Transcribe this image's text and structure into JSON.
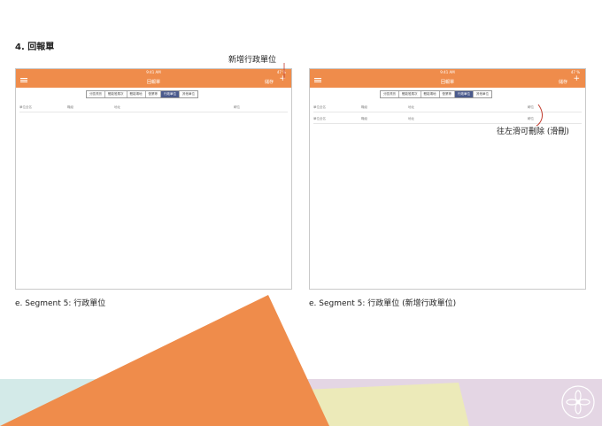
{
  "page": {
    "section_title": "4. 回報單",
    "captions": [
      "e. Segment 5: 行政單位",
      "e. Segment 5: 行政單位 (新增行政單位)"
    ],
    "callouts": {
      "add_unit": "新增行政單位",
      "swipe_delete": "往左滑可刪除 (滑刪)"
    },
    "colors": {
      "accent": "#ef8c4b",
      "segment_active": "#4a5a8c",
      "stripe_teal": "#d3eae8",
      "stripe_lilac": "#e4d6e4",
      "stripe_yellow": "#eceab9"
    }
  },
  "screens": [
    {
      "status": {
        "time": "9:41 AM",
        "battery": "47 %"
      },
      "appbar": {
        "title": "回報單",
        "action_text": "儲存",
        "menu_icon": "hamburger-icon",
        "add_icon": "plus-icon"
      },
      "segments": [
        "分區資訊",
        "體能發展次",
        "體能場地",
        "營業等",
        "行政單位",
        "其他單位"
      ],
      "active_segment": 4,
      "table": {
        "header": [
          "單位全名",
          "職級",
          "地址",
          "轉位"
        ],
        "rows": []
      }
    },
    {
      "status": {
        "time": "9:41 AM",
        "battery": "47 %"
      },
      "appbar": {
        "title": "回報單",
        "action_text": "儲存",
        "menu_icon": "hamburger-icon",
        "add_icon": "plus-icon"
      },
      "segments": [
        "分區資訊",
        "體能發展次",
        "體能場地",
        "營業等",
        "行政單位",
        "其他單位"
      ],
      "active_segment": 4,
      "table": {
        "header": [],
        "rows": [
          [
            "單位全名",
            "職級",
            "地址",
            "轉位"
          ],
          [
            "單位全名",
            "職級",
            "地址",
            "轉位"
          ]
        ]
      }
    }
  ]
}
